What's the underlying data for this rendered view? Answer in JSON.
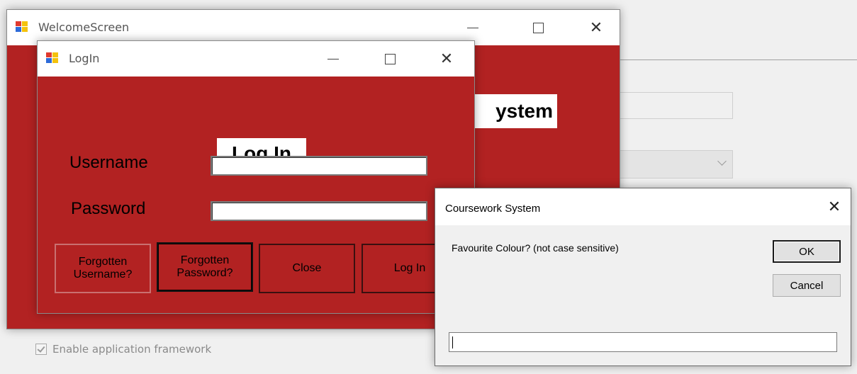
{
  "background": {
    "enable_framework_label": "Enable application framework"
  },
  "welcome": {
    "title": "WelcomeScreen",
    "heading_partial": "ystem",
    "accent_color": "#b22222"
  },
  "login": {
    "title": "LogIn",
    "heading": "Log In",
    "username_label": "Username",
    "password_label": "Password",
    "username_value": "",
    "password_value": "",
    "buttons": {
      "forgot_username": "Forgotten Username?",
      "forgot_password": "Forgotten Password?",
      "close": "Close",
      "login": "Log In"
    }
  },
  "dialog": {
    "title": "Coursework System",
    "prompt": "Favourite Colour? (not case sensitive)",
    "ok_label": "OK",
    "cancel_label": "Cancel",
    "input_value": "",
    "close_glyph": "✕"
  },
  "titlebar_glyphs": {
    "close": "✕"
  }
}
